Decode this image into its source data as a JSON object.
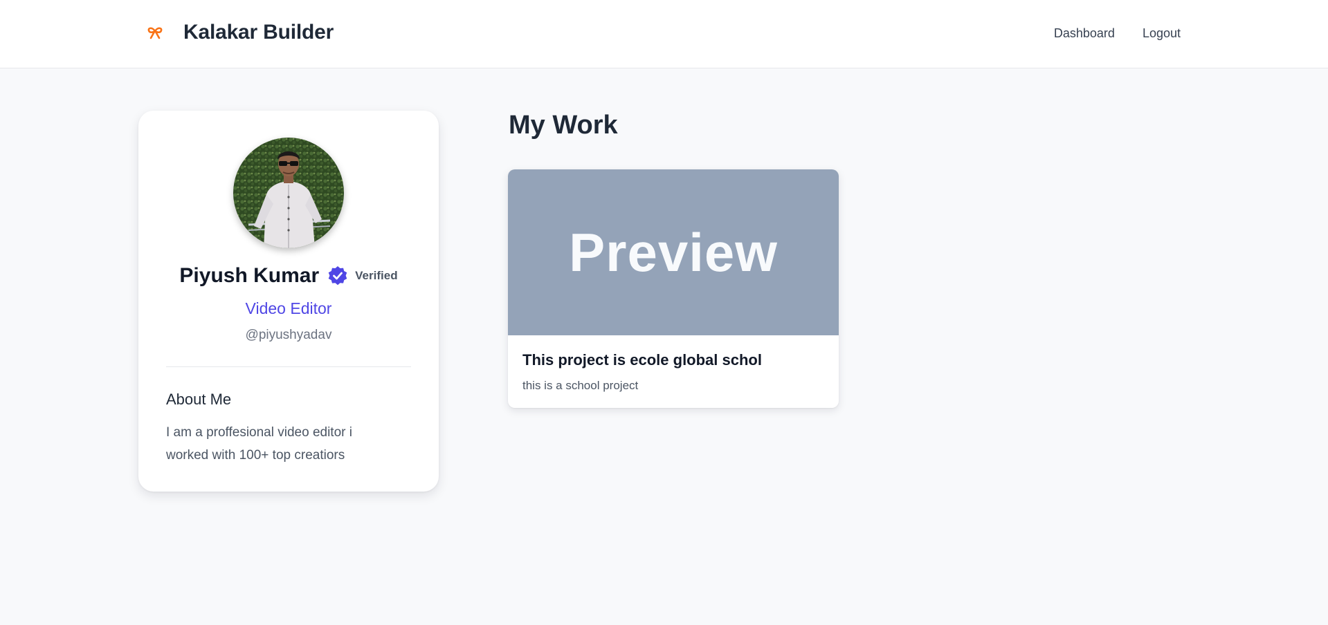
{
  "header": {
    "brand_title": "Kalakar Builder",
    "brand_icon": "ribbon-icon",
    "nav": [
      {
        "label": "Dashboard"
      },
      {
        "label": "Logout"
      }
    ]
  },
  "profile": {
    "avatar": "avatar-photo",
    "name": "Piyush Kumar",
    "verified_label": "Verified",
    "role": "Video Editor",
    "handle": "@piyushyadav",
    "about_title": "About Me",
    "about_text": "I am a proffesional video editor i worked with 100+ top creatiors"
  },
  "work": {
    "section_title": "My Work",
    "items": [
      {
        "preview_label": "Preview",
        "title": "This project is ecole global schol",
        "description": "this is a school project"
      }
    ]
  },
  "colors": {
    "accent": "#4f46e5",
    "brand_icon": "#f97316",
    "preview_bg": "#94a3b8",
    "page_bg": "#f8f9fb"
  }
}
